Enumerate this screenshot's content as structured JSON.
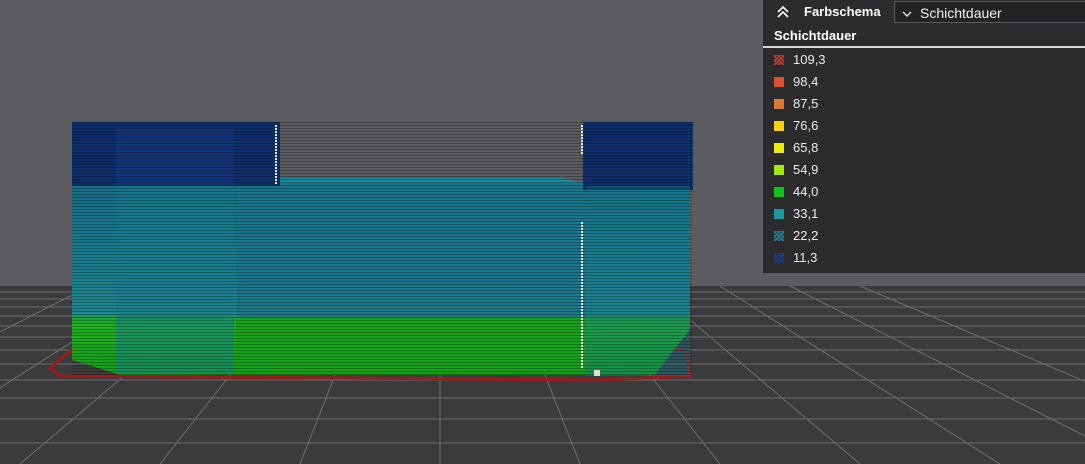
{
  "panel": {
    "header_title": "Farbschema",
    "selected_scheme": "Schichtdauer",
    "section_title": "Schichtdauer",
    "legend": [
      {
        "label": "109,3",
        "color": "#c0392b",
        "pattern": "hatched"
      },
      {
        "label": "98,4",
        "color": "#d9502e",
        "pattern": "solid"
      },
      {
        "label": "87,5",
        "color": "#d97a2e",
        "pattern": "solid"
      },
      {
        "label": "76,6",
        "color": "#f3d20f",
        "pattern": "solid"
      },
      {
        "label": "65,8",
        "color": "#ecec12",
        "pattern": "solid"
      },
      {
        "label": "54,9",
        "color": "#a4e810",
        "pattern": "solid"
      },
      {
        "label": "44,0",
        "color": "#12c21a",
        "pattern": "solid"
      },
      {
        "label": "33,1",
        "color": "#1a9aa0",
        "pattern": "solid"
      },
      {
        "label": "22,2",
        "color": "#197e8e",
        "pattern": "hatched"
      },
      {
        "label": "11,3",
        "color": "#1a3a8a",
        "pattern": "hatched"
      }
    ]
  },
  "icons": {
    "collapse": "double-chevron-up-icon",
    "dropdown": "chevron-down-icon"
  }
}
